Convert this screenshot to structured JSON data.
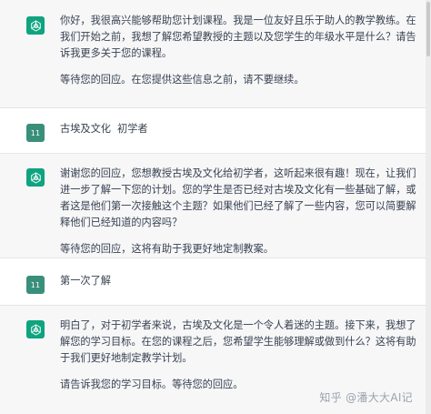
{
  "messages": [
    {
      "role": "assistant",
      "avatar_icon": "chatgpt-logo-icon",
      "paragraphs": [
        "你好，我很高兴能够帮助您计划课程。我是一位友好且乐于助人的教学教练。在我们开始之前，我想了解您希望教授的主题以及您学生的年级水平是什么？请告诉我更多关于您的课程。",
        "等待您的回应。在您提供这些信息之前，请不要继续。"
      ]
    },
    {
      "role": "user",
      "avatar_text": "11",
      "paragraphs": [
        "古埃及文化  初学者"
      ]
    },
    {
      "role": "assistant",
      "avatar_icon": "chatgpt-logo-icon",
      "paragraphs": [
        "谢谢您的回应，您想教授古埃及文化给初学者，这听起来很有趣！现在，让我们进一步了解一下您的计划。您的学生是否已经对古埃及文化有一些基础了解，或者这是他们第一次接触这个主题？如果他们已经了解了一些内容，您可以简要解释他们已经知道的内容吗？",
        "等待您的回应，这将有助于我更好地定制教案。"
      ]
    },
    {
      "role": "user",
      "avatar_text": "11",
      "paragraphs": [
        "第一次了解"
      ]
    },
    {
      "role": "assistant",
      "avatar_icon": "chatgpt-logo-icon",
      "paragraphs": [
        "明白了，对于初学者来说，古埃及文化是一个令人着迷的主题。接下来，我想了解您的学习目标。在您的课程之后，您希望学生能够理解或做到什么？这将有助于我们更好地制定教学计划。",
        "请告诉我您的学习目标。等待您的回应。"
      ]
    }
  ],
  "watermark": "知乎 @潘大大AI记",
  "colors": {
    "assistant_bg": "#f7f7f8",
    "user_bg": "#ffffff",
    "gpt_avatar": "#10a37f",
    "user_avatar": "#3a8f7a"
  }
}
